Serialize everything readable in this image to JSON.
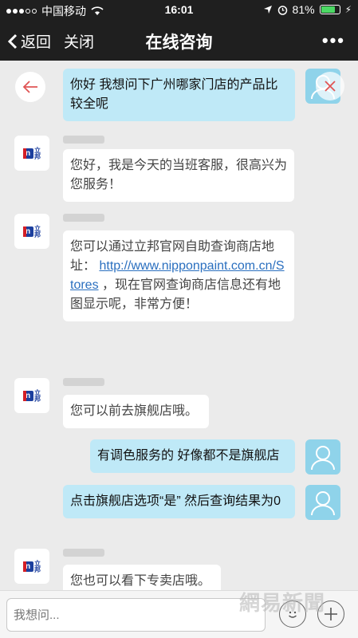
{
  "status": {
    "carrier": "中国移动",
    "time": "16:01",
    "battery": "81%",
    "battery_level": 0.81
  },
  "nav": {
    "back_label": "返回",
    "close_label": "关闭",
    "title": "在线咨询",
    "more_label": "•••"
  },
  "messages": [
    {
      "side": "right",
      "text": "你好 我想问下广州哪家门店的产品比较全呢"
    },
    {
      "side": "left",
      "text": "您好，我是今天的当班客服，很高兴为您服务！"
    },
    {
      "side": "left",
      "text_before": "您可以通过立邦官网自助查询商店地址：",
      "link": "http://www.nipponpaint.com.cn/Stores",
      "text_after": "，现在官网查询商店信息还有地图显示呢，非常方便！"
    },
    {
      "side": "left",
      "text": "您可以前去旗舰店哦。"
    },
    {
      "side": "right",
      "text": "有调色服务的 好像都不是旗舰店"
    },
    {
      "side": "right",
      "text": "点击旗舰店选项“是” 然后查询结果为0"
    },
    {
      "side": "left",
      "text": "您也可以看下专卖店哦。"
    }
  ],
  "brand_logo": {
    "mark": "n",
    "cn": "立邦"
  },
  "input": {
    "placeholder": "我想问..."
  },
  "watermark": "網易新聞"
}
